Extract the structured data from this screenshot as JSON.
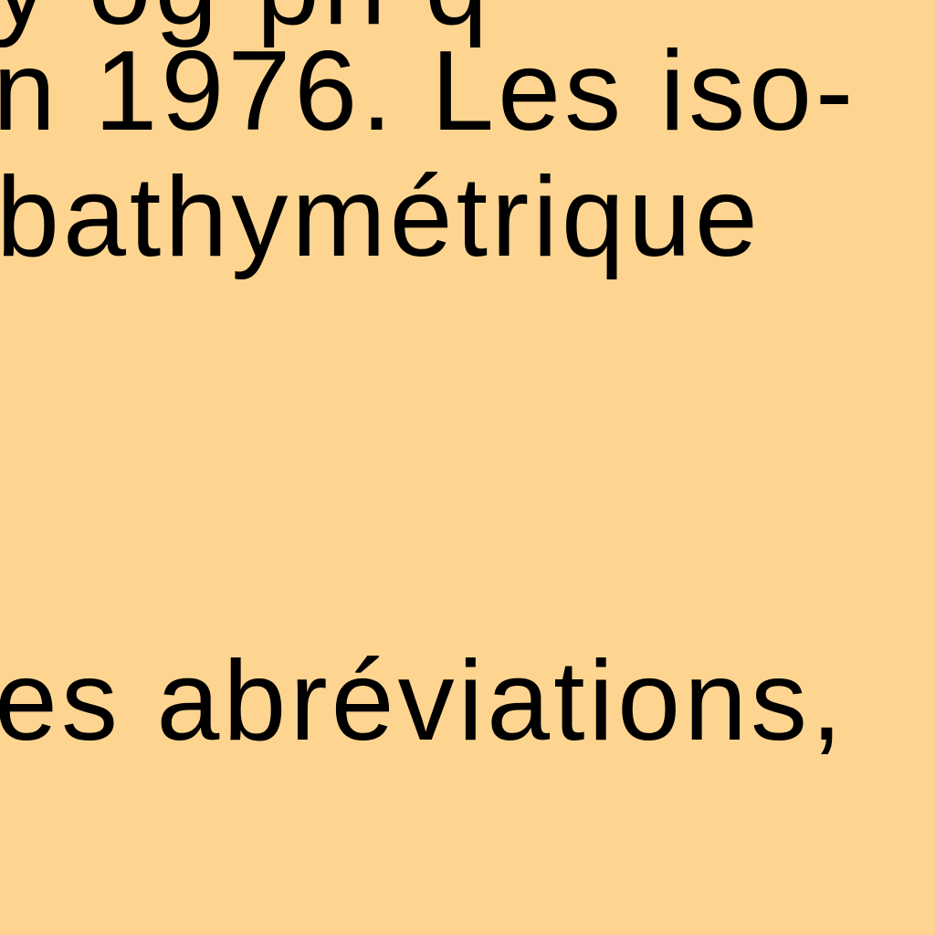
{
  "document": {
    "background_color": "#FED590",
    "text_color": "#000000",
    "lines": [
      "y og ph q",
      "n 1976. Les iso-",
      "bathymétrique",
      "es abréviations,"
    ]
  }
}
